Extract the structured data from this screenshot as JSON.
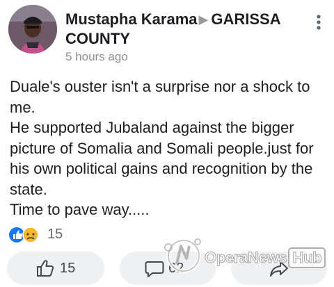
{
  "post": {
    "author": "Mustapha Karama",
    "group": "GARISSA COUNTY",
    "timestamp": "5 hours ago",
    "body": "Duale's ouster isn't a surprise nor a shock to me.\n   He supported Jubaland against the bigger picture of Somalia and Somali people.just for his own political gains and recognition by the state.\n  Time to pave way.....",
    "reactions": {
      "count": "15",
      "types": [
        "like-icon",
        "sad-icon"
      ]
    }
  },
  "actions": {
    "like_count": "15",
    "comment_count": "62"
  },
  "watermark": {
    "brand": "OperaNews",
    "suffix": "Hub"
  },
  "colors": {
    "like_blue": "#1877f2",
    "sad_yellow": "#f7b928",
    "muted_text": "#65676b",
    "pill_background": "#eef0f2"
  }
}
